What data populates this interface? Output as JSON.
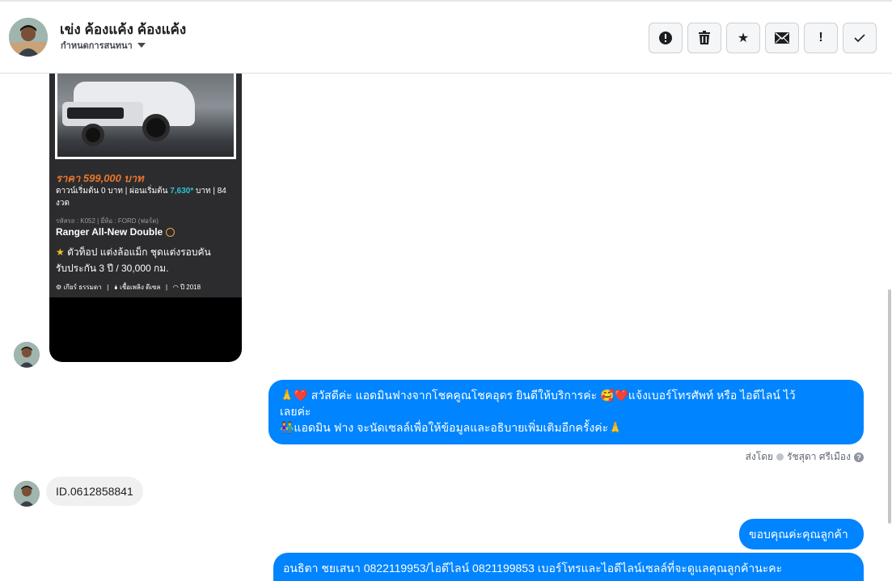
{
  "header": {
    "name": "เข่ง ค้องแค้ง ค้องแค้ง",
    "subtitle": "กำหนดการสนทนา",
    "actions": [
      {
        "icon": "alert-circle-icon",
        "glyph": "!"
      },
      {
        "icon": "trash-icon",
        "glyph": ""
      },
      {
        "icon": "star-icon",
        "glyph": "★"
      },
      {
        "icon": "envelope-icon",
        "glyph": "✉"
      },
      {
        "icon": "exclamation-icon",
        "glyph": "!"
      },
      {
        "icon": "checkmark-icon",
        "glyph": "✓"
      }
    ]
  },
  "listing": {
    "price": "ราคา 599,000 บาท",
    "down_prefix": "ดาวน์เริ่มต้น 0 บาท | ผ่อนเริ่มต้น ",
    "installment": "7,630*",
    "down_suffix": " บาท | 84 งวด",
    "meta": "รหัสรถ : K052 | ยี่ห้อ : FORD (ฟอร์ด)",
    "model": "Ranger All-New Double",
    "desc_line1": "ตัวท็อป แต่งล้อแม็ก ชุดแต่งรอบคัน",
    "desc_line2": "รับประกัน 3 ปี / 30,000 กม.",
    "spec_gear": "เกียร์ ธรรมดา",
    "spec_fuel": "เชื้อเพลิง ดีเซล",
    "spec_year": "ปี 2018"
  },
  "messages": {
    "greeting_line1": "🙏❤️ สวัสดีค่ะ แอดมินฟางจากโชคคูณโชคอุดร ยินดีให้บริการค่ะ 🥰❤️แจ้งเบอร์โทรศัพท์ หรือ ไอดีไลน์ ไว้",
    "greeting_line2": "เลยค่ะ",
    "greeting_line3": "👫แอดมิน ฟาง จะนัดเซลล์เพื่อให้ข้อมูลและอธิบายเพิ่มเติมอีกครั้งค่ะ🙏",
    "sent_by_label": "ส่งโดย",
    "sent_by_name": "รัชสุดา ศรีเมือง",
    "customer_id": "ID.0612858841",
    "thanks": "ขอบคุณค่ะคุณลูกค้า",
    "followup": "อนธิตา ชยเสนา      0822119953/ไอดีไลน์ 0821199853  เบอร์โทรและไอดีไลน์เซลล์ที่จะดูแลคุณลูกค้านะคะ"
  },
  "colors": {
    "outgoing_bubble": "#0084ff",
    "incoming_bubble": "#f1f0f0",
    "price_orange": "#e8762d",
    "installment_teal": "#2fc3d6"
  }
}
